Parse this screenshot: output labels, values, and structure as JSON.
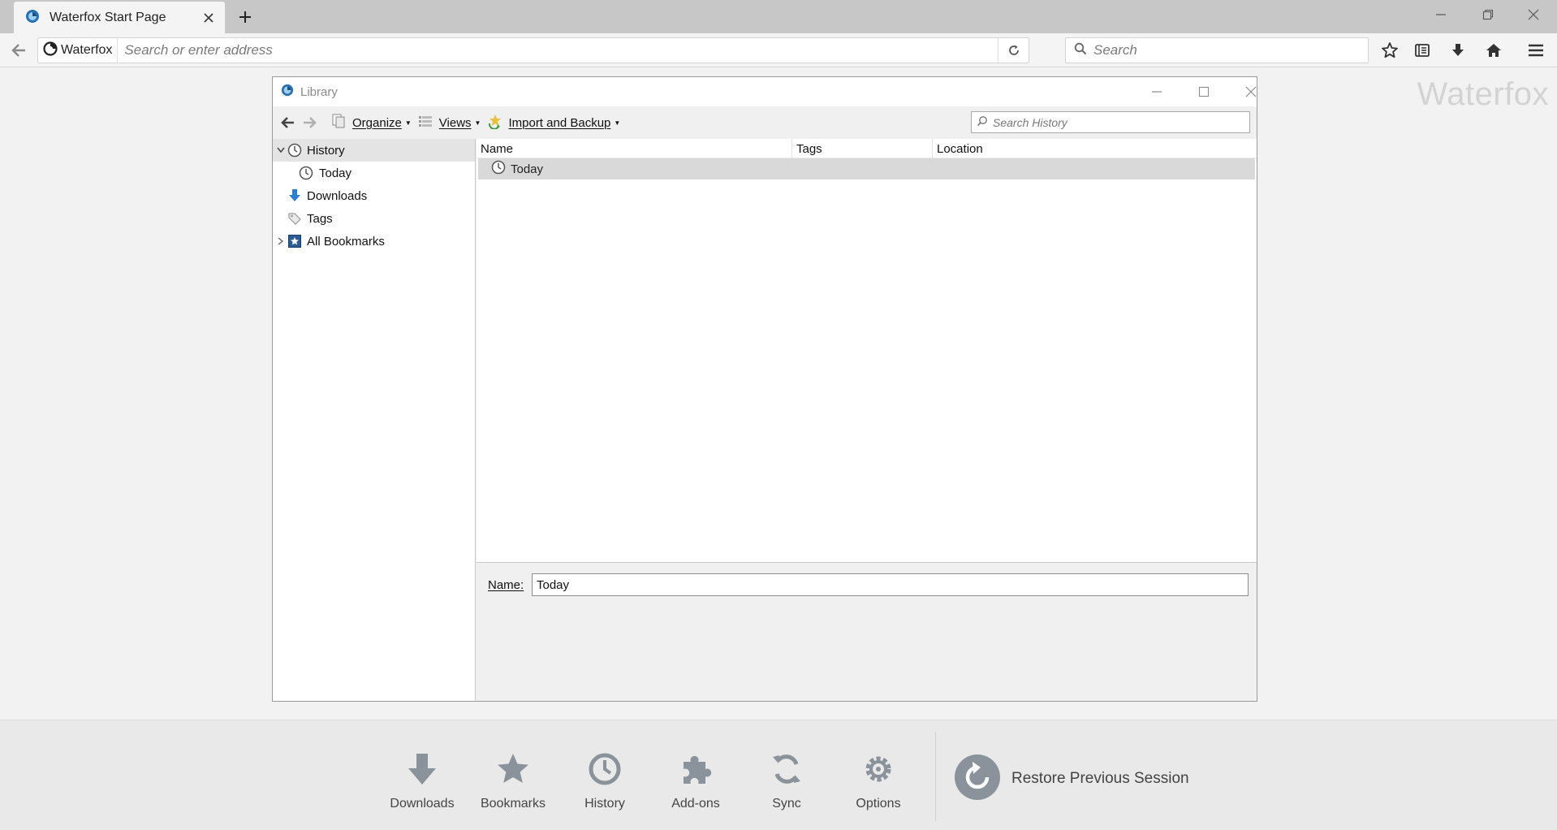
{
  "browser": {
    "tab_title": "Waterfox Start Page",
    "identity_label": "Waterfox",
    "url_placeholder": "Search or enter address",
    "search_placeholder": "Search"
  },
  "page": {
    "brand": "Waterfox",
    "launcher": [
      {
        "label": "Downloads",
        "icon": "download-icon"
      },
      {
        "label": "Bookmarks",
        "icon": "star-icon"
      },
      {
        "label": "History",
        "icon": "clock-icon"
      },
      {
        "label": "Add-ons",
        "icon": "puzzle-icon"
      },
      {
        "label": "Sync",
        "icon": "sync-icon"
      },
      {
        "label": "Options",
        "icon": "gear-icon"
      }
    ],
    "restore_label": "Restore Previous Session"
  },
  "library": {
    "title": "Library",
    "toolbar": {
      "organize": "Organize",
      "views": "Views",
      "import_backup": "Import and Backup"
    },
    "search_placeholder": "Search History",
    "sidebar": [
      {
        "label": "History",
        "icon": "clock-icon"
      },
      {
        "label": "Today",
        "icon": "clock-icon"
      },
      {
        "label": "Downloads",
        "icon": "download-icon"
      },
      {
        "label": "Tags",
        "icon": "tag-icon"
      },
      {
        "label": "All Bookmarks",
        "icon": "bookmarks-icon"
      }
    ],
    "columns": [
      "Name",
      "Tags",
      "Location"
    ],
    "rows": [
      {
        "name": "Today",
        "tags": "",
        "location": ""
      }
    ],
    "details": {
      "name_label": "Name:",
      "name_value": "Today"
    }
  },
  "colors": {
    "accent_blue": "#2f7fd1",
    "icon_gray": "#6f7c87"
  }
}
